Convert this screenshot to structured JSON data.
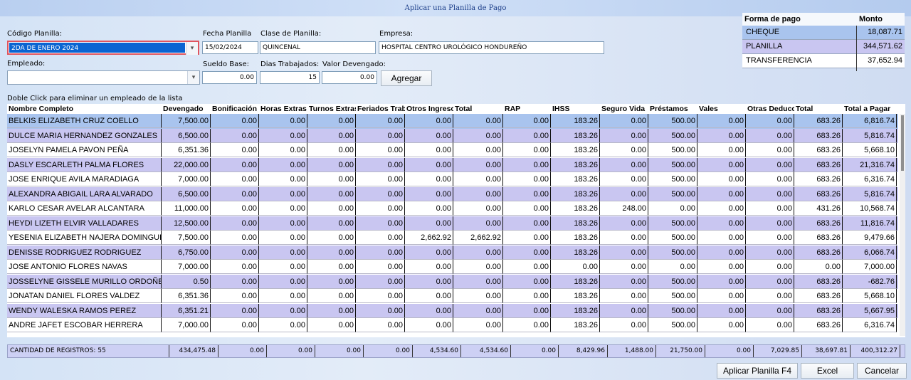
{
  "window": {
    "title": "Aplicar una Planilla de Pago"
  },
  "form": {
    "codigo_label": "Código Planilla:",
    "codigo_value": "2DA DE ENERO 2024",
    "fecha_label": "Fecha Planilla",
    "fecha_value": "15/02/2024",
    "clase_label": "Clase de Planilla:",
    "clase_value": "QUINCENAL",
    "empresa_label": "Empresa:",
    "empresa_value": "HOSPITAL CENTRO UROLÓGICO HONDUREÑO",
    "empleado_label": "Empleado:",
    "empleado_value": "",
    "sueldo_label": "Sueldo Base:",
    "sueldo_value": "0.00",
    "dias_label": "Dias Trabajados:",
    "dias_value": "15",
    "valor_label": "Valor Devengado:",
    "valor_value": "0.00",
    "agregar_label": "Agregar",
    "hint": "Doble Click para eliminar un empleado de la lista"
  },
  "payment": {
    "headers": [
      "Forma de pago",
      "Monto"
    ],
    "rows": [
      {
        "method": "CHEQUE",
        "amount": "18,087.71"
      },
      {
        "method": "PLANILLA",
        "amount": "344,571.62"
      },
      {
        "method": "TRANSFERENCIA",
        "amount": "37,652.94"
      }
    ]
  },
  "grid": {
    "columns": [
      "Nombre Completo",
      "Devengado",
      "Bonificación",
      "Horas Extras",
      "Turnos Extras",
      "Feriados Trab",
      "Otros Ingresos",
      "Total",
      "RAP",
      "IHSS",
      "Seguro Vida",
      "Préstamos",
      "Vales",
      "Otras Deducc",
      "Total",
      "Total a Pagar"
    ],
    "rows": [
      [
        "BELKIS ELIZABETH CRUZ COELLO",
        "7,500.00",
        "0.00",
        "0.00",
        "0.00",
        "0.00",
        "0.00",
        "0.00",
        "0.00",
        "183.26",
        "0.00",
        "500.00",
        "0.00",
        "0.00",
        "683.26",
        "6,816.74"
      ],
      [
        "DULCE MARIA HERNANDEZ GONZALES",
        "6,500.00",
        "0.00",
        "0.00",
        "0.00",
        "0.00",
        "0.00",
        "0.00",
        "0.00",
        "183.26",
        "0.00",
        "500.00",
        "0.00",
        "0.00",
        "683.26",
        "5,816.74"
      ],
      [
        "JOSELYN PAMELA PAVON PEÑA",
        "6,351.36",
        "0.00",
        "0.00",
        "0.00",
        "0.00",
        "0.00",
        "0.00",
        "0.00",
        "183.26",
        "0.00",
        "500.00",
        "0.00",
        "0.00",
        "683.26",
        "5,668.10"
      ],
      [
        "DASLY ESCARLETH PALMA FLORES",
        "22,000.00",
        "0.00",
        "0.00",
        "0.00",
        "0.00",
        "0.00",
        "0.00",
        "0.00",
        "183.26",
        "0.00",
        "500.00",
        "0.00",
        "0.00",
        "683.26",
        "21,316.74"
      ],
      [
        "JOSE ENRIQUE AVILA MARADIAGA",
        "7,000.00",
        "0.00",
        "0.00",
        "0.00",
        "0.00",
        "0.00",
        "0.00",
        "0.00",
        "183.26",
        "0.00",
        "500.00",
        "0.00",
        "0.00",
        "683.26",
        "6,316.74"
      ],
      [
        "ALEXANDRA ABIGAIL LARA ALVARADO",
        "6,500.00",
        "0.00",
        "0.00",
        "0.00",
        "0.00",
        "0.00",
        "0.00",
        "0.00",
        "183.26",
        "0.00",
        "500.00",
        "0.00",
        "0.00",
        "683.26",
        "5,816.74"
      ],
      [
        "KARLO CESAR AVELAR ALCANTARA",
        "11,000.00",
        "0.00",
        "0.00",
        "0.00",
        "0.00",
        "0.00",
        "0.00",
        "0.00",
        "183.26",
        "248.00",
        "0.00",
        "0.00",
        "0.00",
        "431.26",
        "10,568.74"
      ],
      [
        "HEYDI LIZETH ELVIR VALLADARES",
        "12,500.00",
        "0.00",
        "0.00",
        "0.00",
        "0.00",
        "0.00",
        "0.00",
        "0.00",
        "183.26",
        "0.00",
        "500.00",
        "0.00",
        "0.00",
        "683.26",
        "11,816.74"
      ],
      [
        "YESENIA ELIZABETH NAJERA DOMINGUEZ",
        "7,500.00",
        "0.00",
        "0.00",
        "0.00",
        "0.00",
        "2,662.92",
        "2,662.92",
        "0.00",
        "183.26",
        "0.00",
        "500.00",
        "0.00",
        "0.00",
        "683.26",
        "9,479.66"
      ],
      [
        "DENISSE RODRIGUEZ RODRIGUEZ",
        "6,750.00",
        "0.00",
        "0.00",
        "0.00",
        "0.00",
        "0.00",
        "0.00",
        "0.00",
        "183.26",
        "0.00",
        "500.00",
        "0.00",
        "0.00",
        "683.26",
        "6,066.74"
      ],
      [
        "JOSE ANTONIO FLORES NAVAS",
        "7,000.00",
        "0.00",
        "0.00",
        "0.00",
        "0.00",
        "0.00",
        "0.00",
        "0.00",
        "0.00",
        "0.00",
        "0.00",
        "0.00",
        "0.00",
        "0.00",
        "7,000.00"
      ],
      [
        "JOSSELYNE GISSELE MURILLO ORDOÑEZ",
        "0.50",
        "0.00",
        "0.00",
        "0.00",
        "0.00",
        "0.00",
        "0.00",
        "0.00",
        "183.26",
        "0.00",
        "500.00",
        "0.00",
        "0.00",
        "683.26",
        "-682.76"
      ],
      [
        "JONATAN DANIEL FLORES VALDEZ",
        "6,351.36",
        "0.00",
        "0.00",
        "0.00",
        "0.00",
        "0.00",
        "0.00",
        "0.00",
        "183.26",
        "0.00",
        "500.00",
        "0.00",
        "0.00",
        "683.26",
        "5,668.10"
      ],
      [
        "WENDY WALESKA RAMOS PEREZ",
        "6,351.21",
        "0.00",
        "0.00",
        "0.00",
        "0.00",
        "0.00",
        "0.00",
        "0.00",
        "183.26",
        "0.00",
        "500.00",
        "0.00",
        "0.00",
        "683.26",
        "5,667.95"
      ],
      [
        "ANDRE JAFET ESCOBAR HERRERA",
        "7,000.00",
        "0.00",
        "0.00",
        "0.00",
        "0.00",
        "0.00",
        "0.00",
        "0.00",
        "183.26",
        "0.00",
        "500.00",
        "0.00",
        "0.00",
        "683.26",
        "6,316.74"
      ]
    ]
  },
  "totals": [
    "CANTIDAD DE REGISTROS: 55",
    "434,475.48",
    "0.00",
    "0.00",
    "0.00",
    "0.00",
    "4,534.60",
    "4,534.60",
    "0.00",
    "8,429.96",
    "1,488.00",
    "21,750.00",
    "0.00",
    "7,029.85",
    "38,697.81",
    "400,312.27"
  ],
  "buttons": {
    "aplicar": "Aplicar Planilla F4",
    "excel": "Excel",
    "cancelar": "Cancelar"
  },
  "colors": {
    "selected_row": "#a9c4ee",
    "alt_row": "#c9c6f1",
    "focus_border": "#e0555f",
    "selection_fill": "#0a64d2"
  }
}
